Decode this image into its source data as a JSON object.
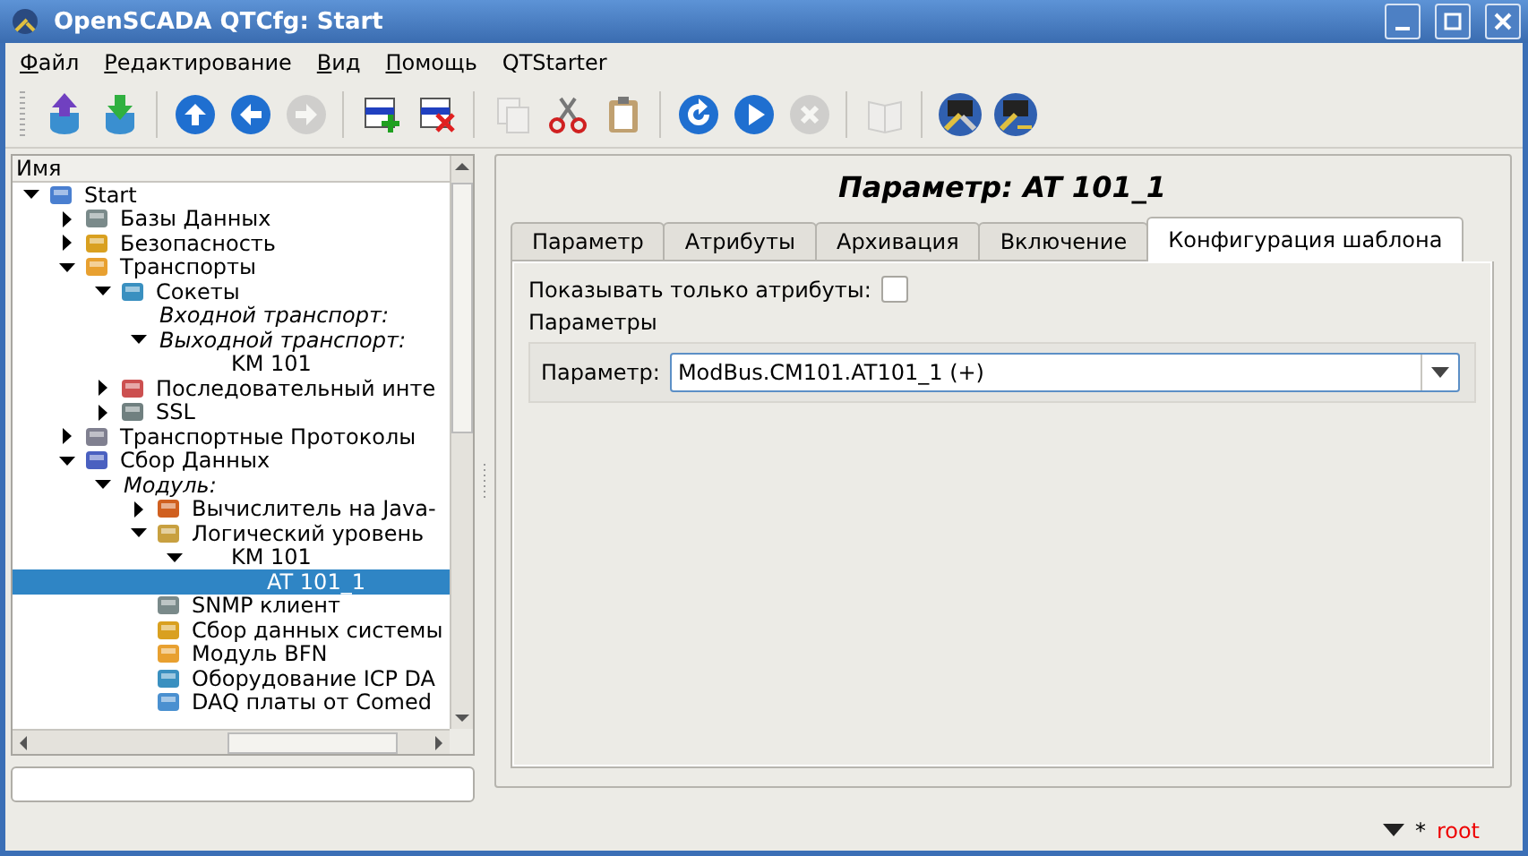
{
  "window": {
    "title": "OpenSCADA QTCfg: Start"
  },
  "menu": [
    {
      "label": "Файл",
      "accel": true
    },
    {
      "label": "Редактирование",
      "accel": true
    },
    {
      "label": "Вид",
      "accel": true
    },
    {
      "label": "Помощь",
      "accel": true
    },
    {
      "label": "QTStarter",
      "accel": false
    }
  ],
  "toolbar": [
    [
      {
        "kind": "db-load",
        "disabled": false
      },
      {
        "kind": "db-save",
        "disabled": false
      }
    ],
    [
      {
        "kind": "up",
        "disabled": false
      },
      {
        "kind": "back",
        "disabled": false
      },
      {
        "kind": "forward",
        "disabled": true
      }
    ],
    [
      {
        "kind": "add",
        "disabled": false
      },
      {
        "kind": "delete",
        "disabled": false
      }
    ],
    [
      {
        "kind": "copy",
        "disabled": true
      },
      {
        "kind": "cut",
        "disabled": false
      },
      {
        "kind": "paste",
        "disabled": false
      }
    ],
    [
      {
        "kind": "refresh",
        "disabled": false
      },
      {
        "kind": "start",
        "disabled": false
      },
      {
        "kind": "stop",
        "disabled": true
      }
    ],
    [
      {
        "kind": "book",
        "disabled": true
      }
    ],
    [
      {
        "kind": "station",
        "disabled": false
      },
      {
        "kind": "station-key",
        "disabled": false
      }
    ]
  ],
  "tree": {
    "header": "Имя",
    "items": [
      {
        "label": "Start",
        "kind": "node",
        "expanded": true,
        "selected": false,
        "children": [
          {
            "label": "Базы Данных",
            "kind": "node",
            "expanded": false,
            "selected": false
          },
          {
            "label": "Безопасность",
            "kind": "node",
            "expanded": false,
            "selected": false
          },
          {
            "label": "Транспорты",
            "kind": "node",
            "expanded": true,
            "selected": false,
            "children": [
              {
                "label": "Сокеты",
                "kind": "node",
                "expanded": true,
                "selected": false,
                "children": [
                  {
                    "label": "Входной транспорт:",
                    "kind": "group",
                    "selected": false
                  },
                  {
                    "label": "Выходной транспорт:",
                    "kind": "group",
                    "expanded": true,
                    "selected": false,
                    "children": [
                      {
                        "label": "KM 101",
                        "kind": "leaf",
                        "selected": false
                      }
                    ]
                  }
                ]
              },
              {
                "label": "Последовательный инте",
                "kind": "node",
                "expanded": false,
                "selected": false
              },
              {
                "label": "SSL",
                "kind": "node",
                "expanded": false,
                "selected": false
              }
            ]
          },
          {
            "label": "Транспортные Протоколы",
            "kind": "node",
            "expanded": false,
            "selected": false
          },
          {
            "label": "Сбор Данных",
            "kind": "node",
            "expanded": true,
            "selected": false,
            "children": [
              {
                "label": "Модуль:",
                "kind": "group",
                "expanded": true,
                "selected": false,
                "children": [
                  {
                    "label": "Вычислитель на Java-",
                    "kind": "node",
                    "expanded": false,
                    "selected": false
                  },
                  {
                    "label": "Логический уровень",
                    "kind": "node",
                    "expanded": true,
                    "selected": false,
                    "children": [
                      {
                        "label": "KM 101",
                        "kind": "leaf",
                        "expanded": true,
                        "selected": false,
                        "children": [
                          {
                            "label": "AT 101_1",
                            "kind": "leaf",
                            "selected": true
                          }
                        ]
                      }
                    ]
                  },
                  {
                    "label": "SNMP клиент",
                    "kind": "node",
                    "selected": false
                  },
                  {
                    "label": "Сбор данных системы",
                    "kind": "node",
                    "selected": false
                  },
                  {
                    "label": "Модуль BFN",
                    "kind": "node",
                    "selected": false
                  },
                  {
                    "label": "Оборудование ICP DA",
                    "kind": "node",
                    "selected": false
                  },
                  {
                    "label": "DAQ платы от Comed",
                    "kind": "node",
                    "selected": false
                  }
                ]
              }
            ]
          }
        ]
      }
    ]
  },
  "panel": {
    "title": "Параметр: AT 101_1",
    "tabs": [
      {
        "label": "Параметр",
        "selected": false
      },
      {
        "label": "Атрибуты",
        "selected": false
      },
      {
        "label": "Архивация",
        "selected": false
      },
      {
        "label": "Включение",
        "selected": false
      },
      {
        "label": "Конфигурация шаблона",
        "selected": true
      }
    ],
    "show_only_attributes": {
      "label": "Показывать только атрибуты:",
      "checked": false
    },
    "group_label": "Параметры",
    "parameter": {
      "label": "Параметр:",
      "value": "ModBus.CM101.AT101_1 (+)"
    }
  },
  "status_bar": {
    "marker": "*",
    "user": "root"
  }
}
